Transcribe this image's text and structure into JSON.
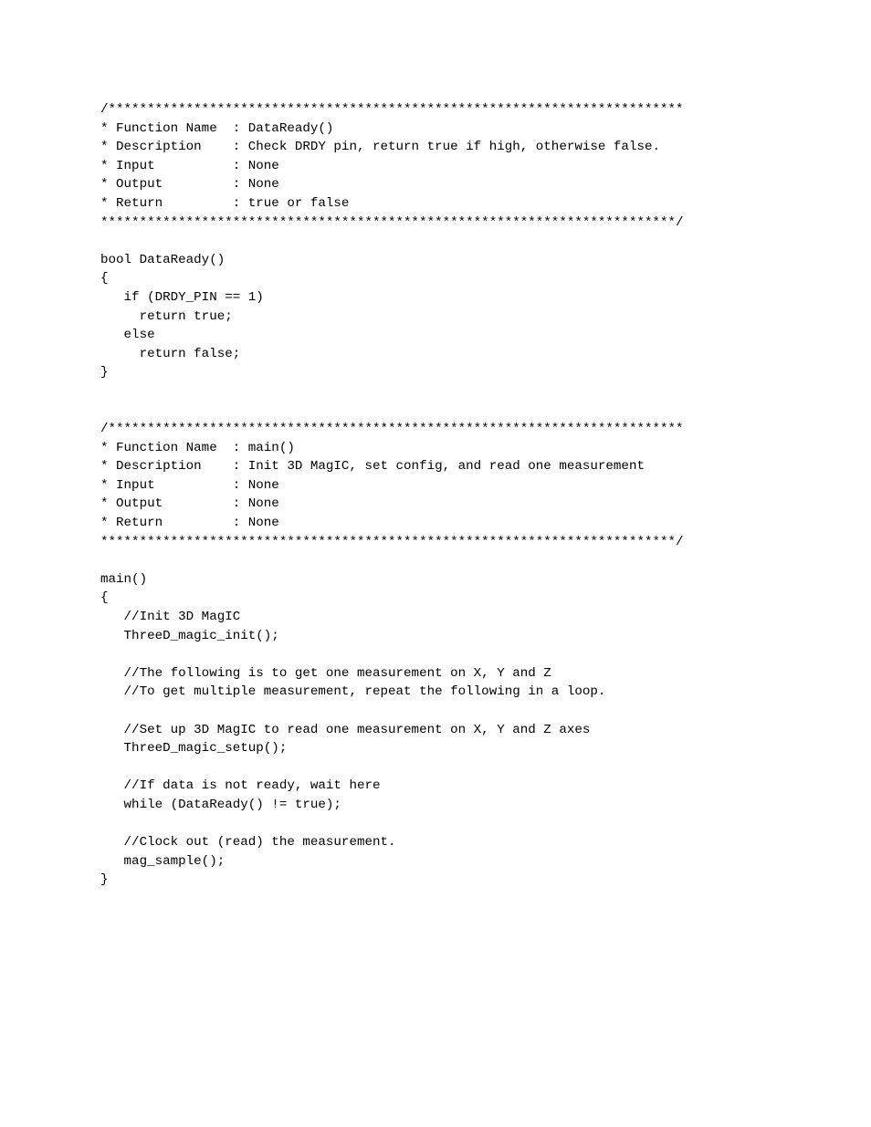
{
  "code_lines": [
    "/**************************************************************************",
    "* Function Name  : DataReady()",
    "* Description    : Check DRDY pin, return true if high, otherwise false.",
    "* Input          : None",
    "* Output         : None",
    "* Return         : true or false",
    "**************************************************************************/",
    "",
    "bool DataReady()",
    "{",
    "   if (DRDY_PIN == 1)",
    "     return true;",
    "   else",
    "     return false;",
    "}",
    "",
    "",
    "/**************************************************************************",
    "* Function Name  : main()",
    "* Description    : Init 3D MagIC, set config, and read one measurement",
    "* Input          : None",
    "* Output         : None",
    "* Return         : None",
    "**************************************************************************/",
    "",
    "main()",
    "{",
    "   //Init 3D MagIC",
    "   ThreeD_magic_init();",
    "",
    "   //The following is to get one measurement on X, Y and Z",
    "   //To get multiple measurement, repeat the following in a loop.",
    "",
    "   //Set up 3D MagIC to read one measurement on X, Y and Z axes",
    "   ThreeD_magic_setup();",
    "",
    "   //If data is not ready, wait here",
    "   while (DataReady() != true);",
    "",
    "   //Clock out (read) the measurement.",
    "   mag_sample();",
    "}"
  ]
}
